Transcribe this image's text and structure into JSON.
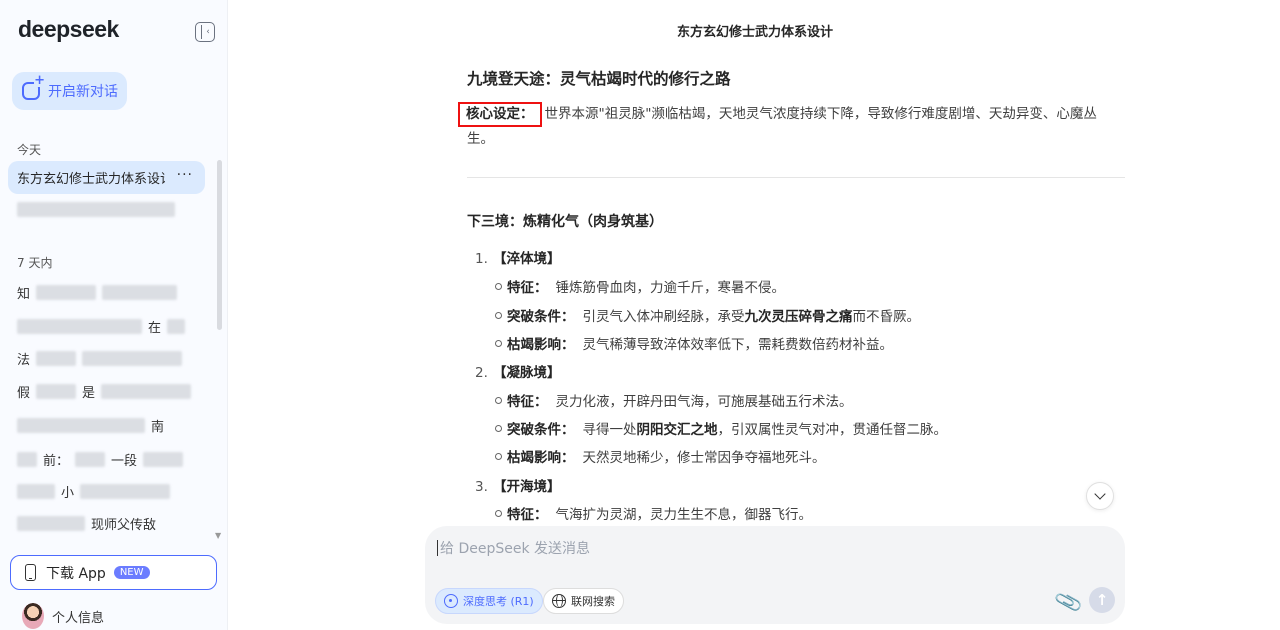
{
  "sidebar": {
    "logo": "deepseek",
    "new_chat_label": "开启新对话",
    "sections": [
      {
        "title": "今天"
      },
      {
        "title": "7 天内"
      }
    ],
    "active_chat": "东方玄幻修士武力体系设计",
    "more_icon": "···",
    "blurred_fragments": [
      "知",
      "在",
      "法",
      "假",
      "是",
      "南",
      "前：",
      "一段",
      "小",
      "现师父传敌"
    ],
    "download_label": "下载 App",
    "new_badge": "NEW",
    "profile_label": "个人信息"
  },
  "header": {
    "title": "东方玄幻修士武力体系设计"
  },
  "content": {
    "heading": "九境登天途：灵气枯竭时代的修行之路",
    "core_key": "核心设定：",
    "core_text": "世界本源\"祖灵脉\"濒临枯竭，天地灵气浓度持续下降，导致修行难度剧增、天劫异变、心魔丛生。",
    "tier_heading": "下三境：炼精化气（肉身筑基）",
    "stages": [
      {
        "num": "1.",
        "name": "【淬体境】",
        "items": [
          {
            "label": "特征：",
            "text": "锤炼筋骨血肉，力逾千斤，寒暑不侵。"
          },
          {
            "label": "突破条件：",
            "pre": "引灵气入体冲刷经脉，承受",
            "bold": "九次灵压碎骨之痛",
            "post": "而不昏厥。"
          },
          {
            "label": "枯竭影响：",
            "text": "灵气稀薄导致淬体效率低下，需耗费数倍药材补益。"
          }
        ]
      },
      {
        "num": "2.",
        "name": "【凝脉境】",
        "items": [
          {
            "label": "特征：",
            "text": "灵力化液，开辟丹田气海，可施展基础五行术法。"
          },
          {
            "label": "突破条件：",
            "pre": "寻得一处",
            "bold": "阴阳交汇之地",
            "post": "，引双属性灵气对冲，贯通任督二脉。"
          },
          {
            "label": "枯竭影响：",
            "text": "天然灵地稀少，修士常因争夺福地死斗。"
          }
        ]
      },
      {
        "num": "3.",
        "name": "【开海境】",
        "items": [
          {
            "label": "特征：",
            "text": "气海扩为灵湖，灵力生生不息，御器飞行。"
          }
        ]
      }
    ]
  },
  "composer": {
    "placeholder": "给 DeepSeek 发送消息",
    "deep_think_label": "深度思考 (R1)",
    "web_search_label": "联网搜索"
  },
  "colors": {
    "accent": "#4d6bfe",
    "active_bg": "#dbeafe",
    "highlight_box": "#ee1111",
    "sidebar_bg": "#f9fbff"
  },
  "icons": {
    "collapse": "sidebar-collapse-icon",
    "new_chat": "new-chat-icon",
    "phone": "phone-icon",
    "scroll_down": "chevron-down-icon",
    "deep_think": "atom-icon",
    "web_search": "globe-icon",
    "attach": "paperclip-icon",
    "send": "arrow-up-icon"
  }
}
